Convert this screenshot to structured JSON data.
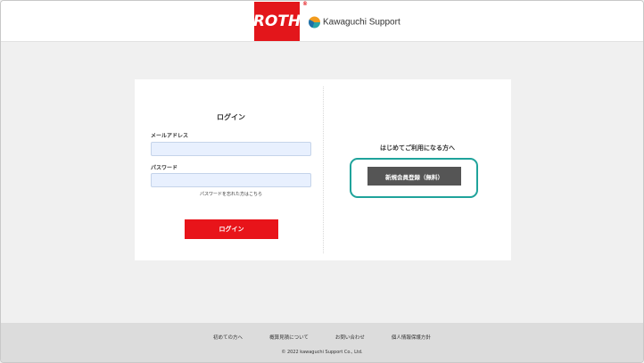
{
  "header": {
    "roth_logo_text": "ROTH",
    "roth_registered_mark": "®",
    "kawaguchi_logo_text": "Kawaguchi Support"
  },
  "login": {
    "title": "ログイン",
    "email_label": "メールアドレス",
    "email_value": "",
    "password_label": "パスワード",
    "password_value": "",
    "forgot_password_link": "パスワードを忘れた方はこちら",
    "submit_label": "ログイン"
  },
  "register": {
    "title": "はじめてご利用になる方へ",
    "button_label": "新規会員登録（無料）"
  },
  "footer": {
    "links": [
      "初めての方へ",
      "概算見積について",
      "お問い合わせ",
      "個人情報保護方針"
    ],
    "copyright": "© 2022 kawaguchi Support Co., Ltd."
  },
  "colors": {
    "brand_red": "#e3161b",
    "highlight_teal": "#1fa39b",
    "register_gray": "#555555",
    "input_bg": "#e8f0fe"
  }
}
